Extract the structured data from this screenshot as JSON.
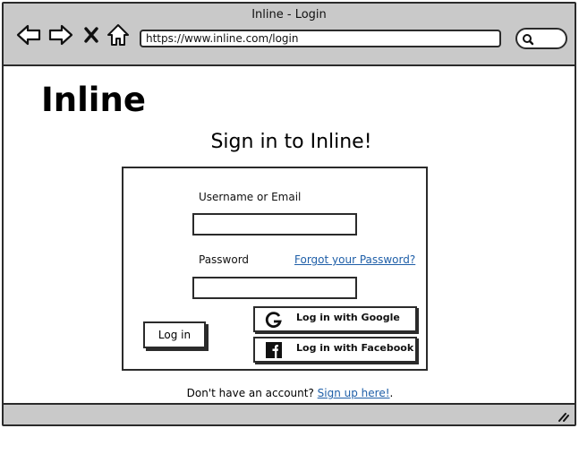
{
  "window": {
    "title": "Inline - Login"
  },
  "browser": {
    "url": "https://www.inline.com/login"
  },
  "logo": {
    "text": "Inline"
  },
  "heading": "Sign in to Inline!",
  "form": {
    "username_label": "Username or Email",
    "username_value": "",
    "password_label": "Password",
    "password_value": "",
    "forgot_link": "Forgot your Password?",
    "login_button": "Log in",
    "google_button": "Log in with Google",
    "facebook_button": "Log in with Facebook"
  },
  "signup": {
    "prompt": "Don't have an account? ",
    "link": "Sign up here!",
    "suffix": "."
  },
  "icons": {
    "back": "arrow-left-icon",
    "forward": "arrow-right-icon",
    "stop": "close-icon",
    "home": "home-icon",
    "search": "search-icon",
    "google": "google-icon",
    "facebook": "facebook-icon",
    "resize": "resize-grip-icon"
  }
}
